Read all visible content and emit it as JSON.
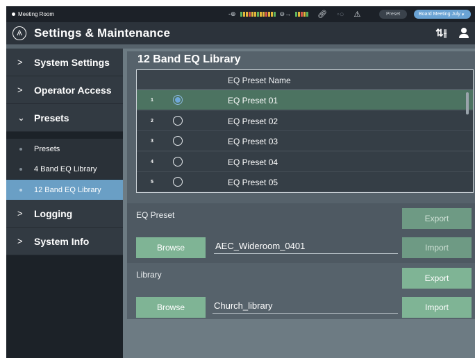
{
  "status_bar": {
    "room": "Meeting Room",
    "preset_label": "Preset",
    "preset_value": "Board Meeting July"
  },
  "header": {
    "title": "Settings & Maintenance"
  },
  "sidebar": {
    "items": [
      {
        "label": "System Settings"
      },
      {
        "label": "Operator Access"
      },
      {
        "label": "Presets"
      },
      {
        "label": "Logging"
      },
      {
        "label": "System Info"
      }
    ],
    "sub_items": [
      {
        "label": "Presets"
      },
      {
        "label": "4 Band EQ Library"
      },
      {
        "label": "12 Band EQ Library"
      }
    ]
  },
  "content": {
    "title": "12 Band EQ Library",
    "table": {
      "header": "EQ Preset Name",
      "rows": [
        {
          "num": "1",
          "name": "EQ Preset 01",
          "selected": true
        },
        {
          "num": "2",
          "name": "EQ Preset 02",
          "selected": false
        },
        {
          "num": "3",
          "name": "EQ Preset 03",
          "selected": false
        },
        {
          "num": "4",
          "name": "EQ Preset 04",
          "selected": false
        },
        {
          "num": "5",
          "name": "EQ Preset 05",
          "selected": false
        }
      ]
    },
    "eq_preset": {
      "label": "EQ Preset",
      "export_label": "Export",
      "browse_label": "Browse",
      "file_value": "AEC_Wideroom_0401",
      "import_label": "Import"
    },
    "library": {
      "label": "Library",
      "export_label": "Export",
      "browse_label": "Browse",
      "file_value": "Church_library",
      "import_label": "Import"
    }
  },
  "colors": {
    "accent_blue": "#6a9fc5",
    "button_green": "#7fb495",
    "selected_row": "#4c7361"
  }
}
